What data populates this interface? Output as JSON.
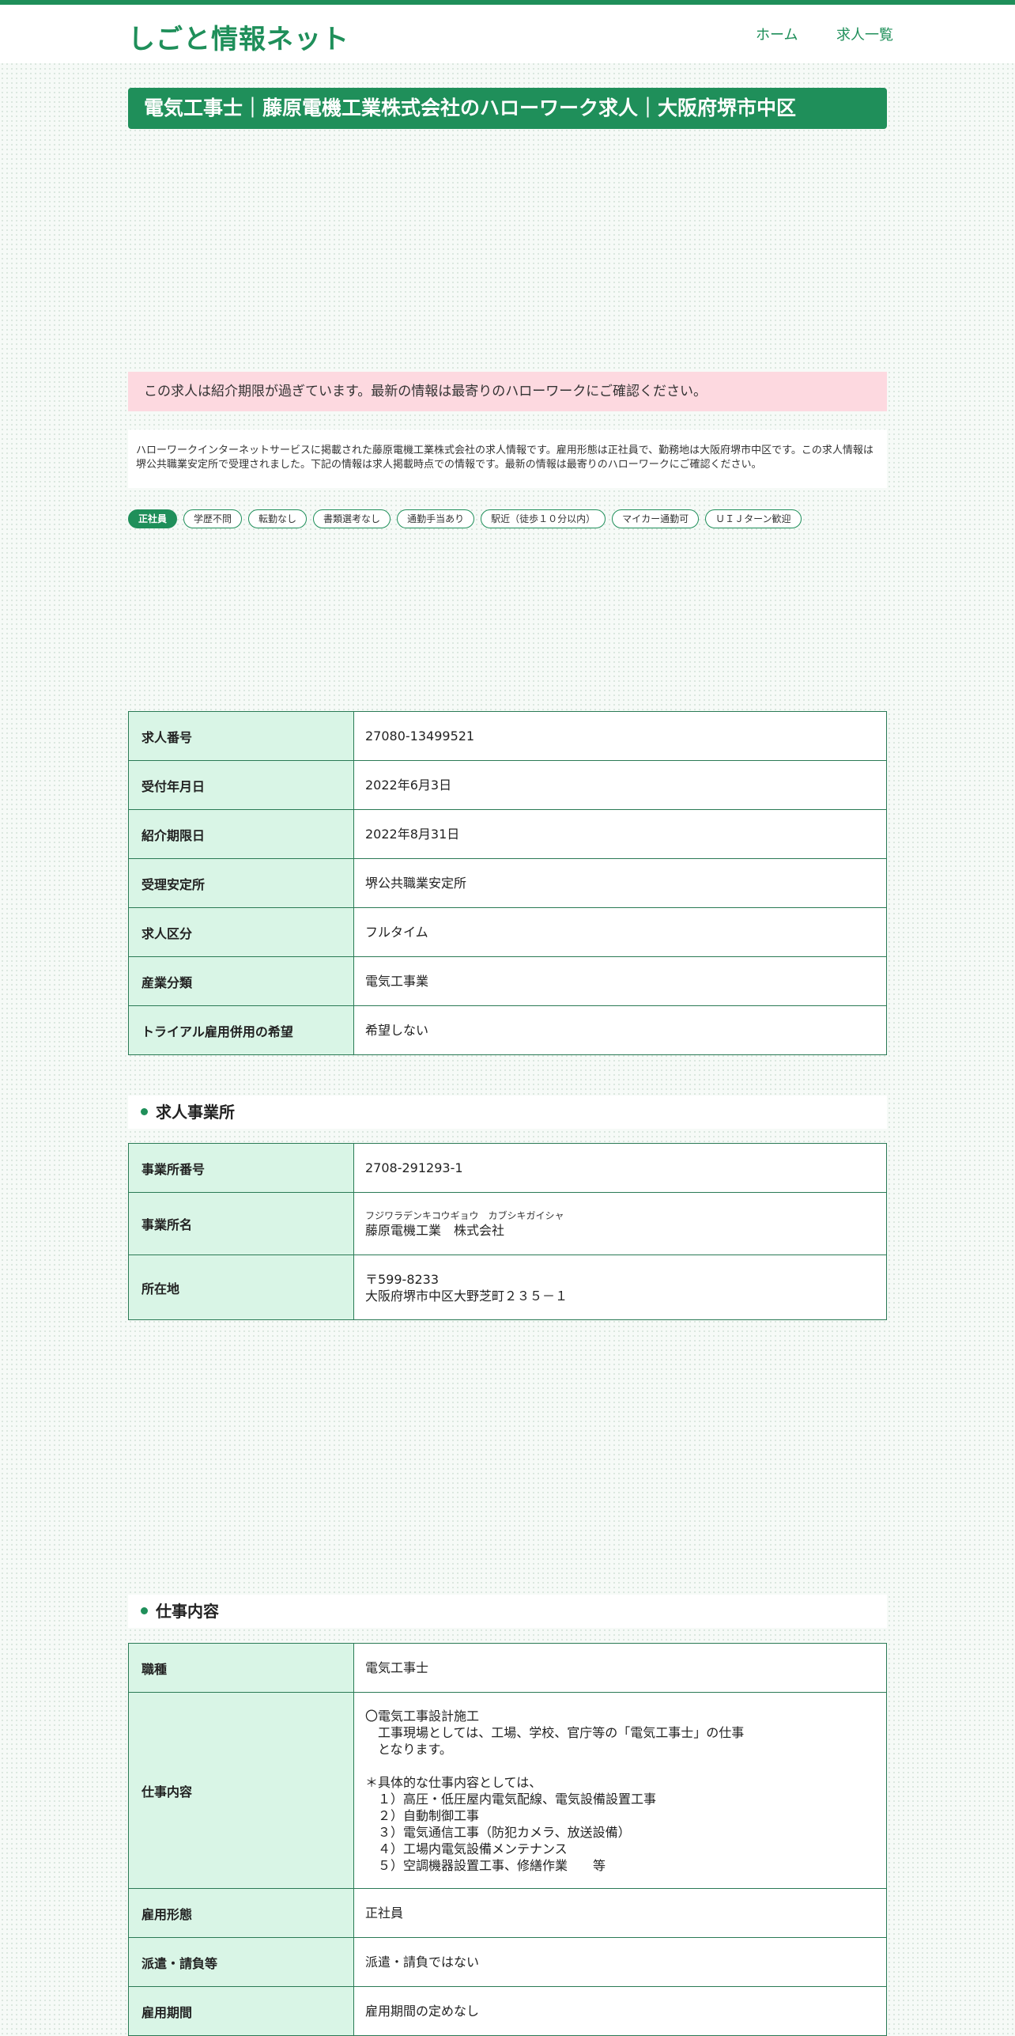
{
  "site": {
    "logo": "しごと情報ネット",
    "nav": {
      "home": "ホーム",
      "list": "求人一覧"
    }
  },
  "page_title": "電気工事士｜藤原電機工業株式会社のハローワーク求人｜大阪府堺市中区",
  "alert_text": "この求人は紹介期限が過ぎています。最新の情報は最寄りのハローワークにご確認ください。",
  "description": "ハローワークインターネットサービスに掲載された藤原電機工業株式会社の求人情報です。雇用形態は正社員で、勤務地は大阪府堺市中区です。この求人情報は堺公共職業安定所で受理されました。下記の情報は求人掲載時点での情報です。最新の情報は最寄りのハローワークにご確認ください。",
  "tags": [
    "正社員",
    "学歴不問",
    "転勤なし",
    "書類選考なし",
    "通勤手当あり",
    "駅近（徒歩１０分以内）",
    "マイカー通勤可",
    "ＵＩＪターン歓迎"
  ],
  "summary_rows": [
    {
      "label": "求人番号",
      "value": "27080-13499521"
    },
    {
      "label": "受付年月日",
      "value": "2022年6月3日"
    },
    {
      "label": "紹介期限日",
      "value": "2022年8月31日"
    },
    {
      "label": "受理安定所",
      "value": "堺公共職業安定所"
    },
    {
      "label": "求人区分",
      "value": "フルタイム"
    },
    {
      "label": "産業分類",
      "value": "電気工事業"
    },
    {
      "label": "トライアル雇用併用の希望",
      "value": "希望しない"
    }
  ],
  "office_section": {
    "heading": "求人事業所",
    "number_label": "事業所番号",
    "number_value": "2708-291293-1",
    "name_label": "事業所名",
    "name_kana": "フジワラデンキコウギョウ　カブシキガイシャ",
    "name_value": "藤原電機工業　株式会社",
    "address_label": "所在地",
    "postal": "〒599-8233",
    "address": "大阪府堺市中区大野芝町２３５－１"
  },
  "job_section": {
    "heading": "仕事内容",
    "occupation_label": "職種",
    "occupation_value": "電気工事士",
    "content_label": "仕事内容",
    "content_value": "〇電気工事設計施工\n　工事現場としては、工場、学校、官庁等の「電気工事士」の仕事\n　となります。\n\n＊具体的な仕事内容としては、\n　１）高圧・低圧屋内電気配線、電気設備設置工事\n　２）自動制御工事\n　３）電気通信工事（防犯カメラ、放送設備）\n　４）工場内電気設備メンテナンス\n　５）空調機器設置工事、修繕作業　　等",
    "employment_label": "雇用形態",
    "employment_value": "正社員",
    "dispatch_label": "派遣・請負等",
    "dispatch_value": "派遣・請負ではない",
    "period_label": "雇用期間",
    "period_value": "雇用期間の定めなし"
  },
  "colors": {
    "brand": "#1f8f5a",
    "alert_bg": "#fdd9e0",
    "label_bg": "#d9f5e6"
  }
}
